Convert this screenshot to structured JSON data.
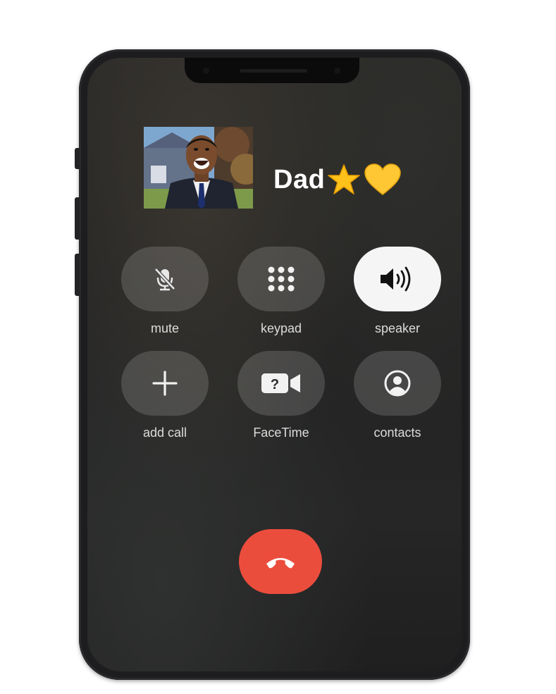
{
  "caller": {
    "name": "Dad",
    "emojis": [
      "star",
      "yellow-heart"
    ]
  },
  "controls": [
    {
      "id": "mute",
      "label": "mute",
      "icon": "mic-slash-icon",
      "active": false
    },
    {
      "id": "keypad",
      "label": "keypad",
      "icon": "keypad-icon",
      "active": false
    },
    {
      "id": "speaker",
      "label": "speaker",
      "icon": "speaker-icon",
      "active": true
    },
    {
      "id": "add-call",
      "label": "add call",
      "icon": "plus-icon",
      "active": false
    },
    {
      "id": "facetime",
      "label": "FaceTime",
      "icon": "facetime-question-icon",
      "active": false
    },
    {
      "id": "contacts",
      "label": "contacts",
      "icon": "contact-icon",
      "active": false
    }
  ],
  "end_call": {
    "icon": "end-call-icon"
  },
  "colors": {
    "end_call": "#eb4d3d",
    "button_bg": "rgba(255,255,255,0.15)",
    "active_button": "#f5f5f5",
    "label_text": "#dcdcdc"
  }
}
